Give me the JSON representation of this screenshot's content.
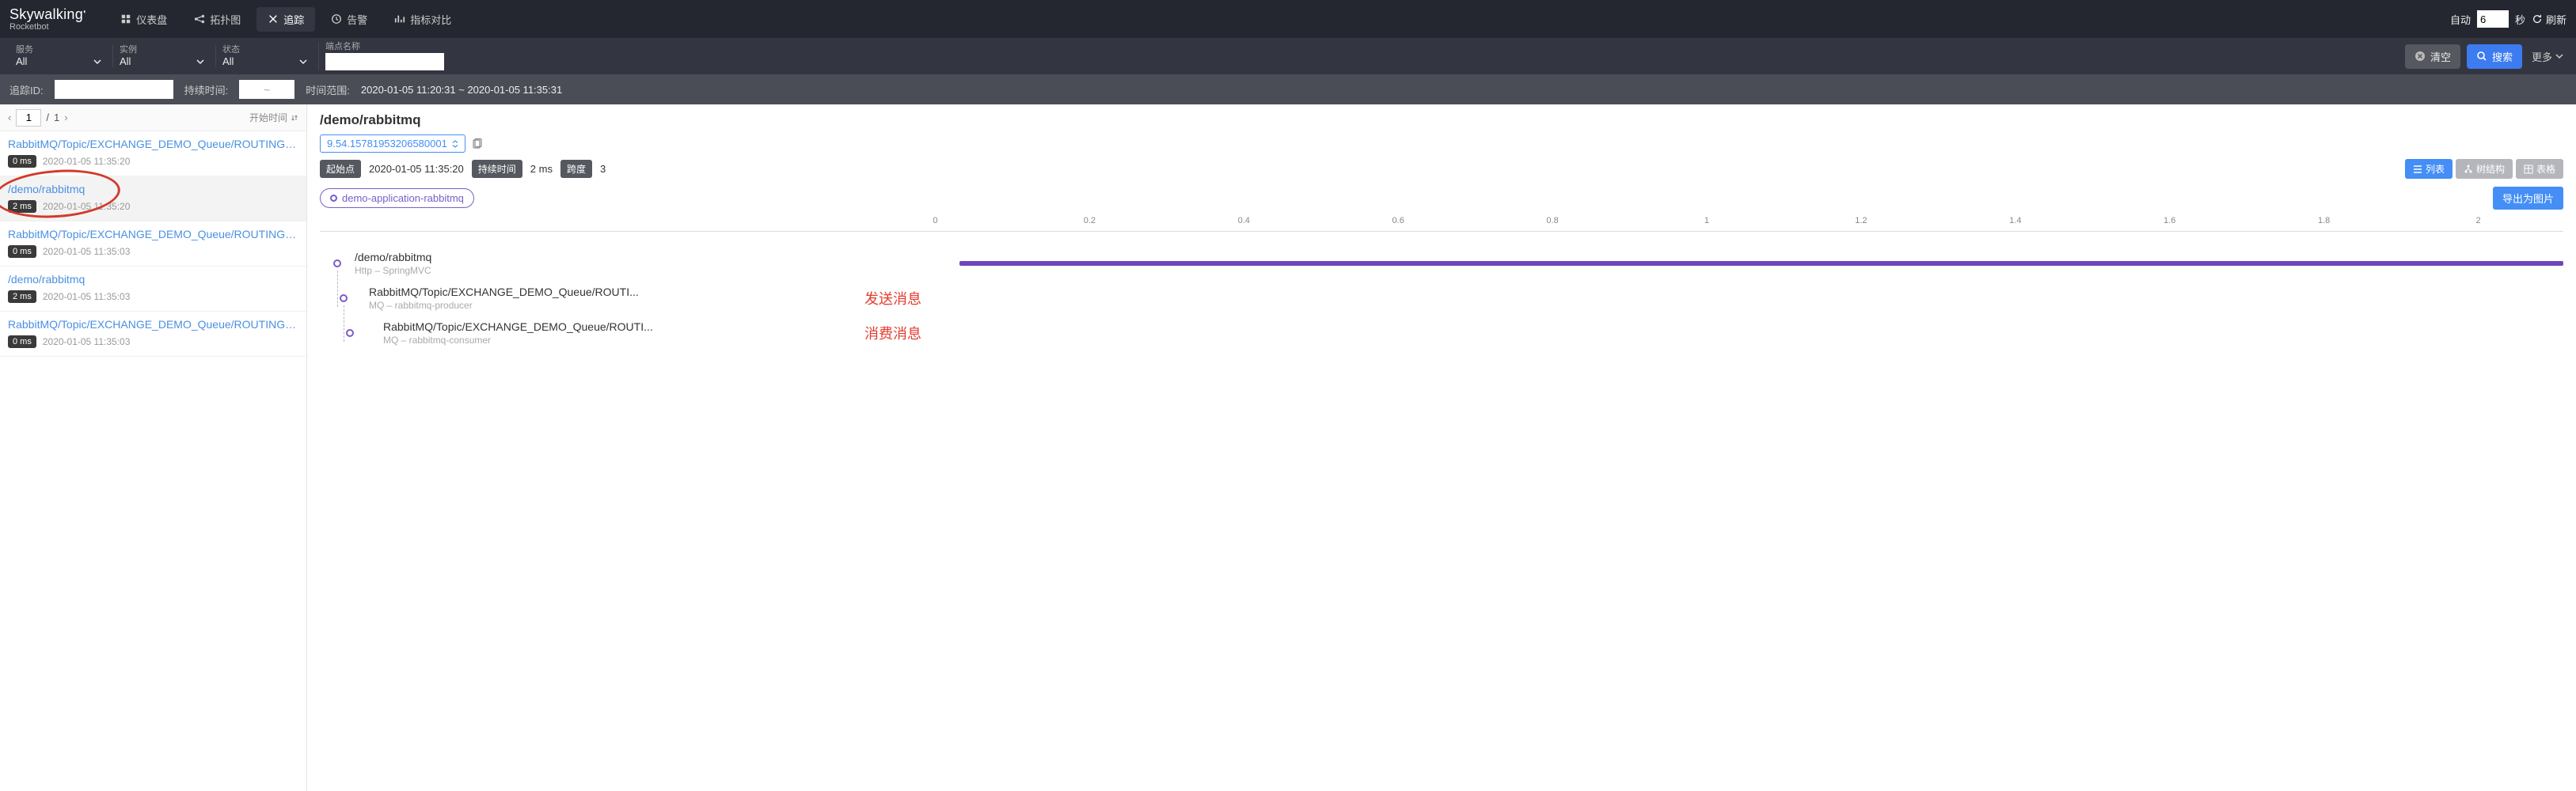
{
  "brand": {
    "main": "Skywalking",
    "sub": "Rocketbot"
  },
  "nav": {
    "dashboard": "仪表盘",
    "topology": "拓扑图",
    "trace": "追踪",
    "alarm": "告警",
    "compare": "指标对比"
  },
  "auto": {
    "label": "自动",
    "seconds": "6",
    "unit": "秒",
    "refresh": "刷新"
  },
  "filter": {
    "service_label": "服务",
    "service_value": "All",
    "instance_label": "实例",
    "instance_value": "All",
    "state_label": "状态",
    "state_value": "All",
    "endpoint_label": "端点名称",
    "endpoint_value": ""
  },
  "actions": {
    "clear": "清空",
    "search": "搜索",
    "more": "更多"
  },
  "filter2": {
    "traceid_label": "追踪ID:",
    "traceid_value": "",
    "duration_label": "持续时间:",
    "duration_value": "~",
    "timerange_label": "时间范围:",
    "timerange_value": "2020-01-05 11:20:31 ~ 2020-01-05 11:35:31"
  },
  "pager": {
    "page": "1",
    "total": "1"
  },
  "sort_label": "开始时间",
  "traces": [
    {
      "name": "RabbitMQ/Topic/EXCHANGE_DEMO_Queue/ROUTING_KEY...",
      "dur": "0 ms",
      "time": "2020-01-05 11:35:20",
      "selected": false,
      "marked": false
    },
    {
      "name": "/demo/rabbitmq",
      "dur": "2 ms",
      "time": "2020-01-05 11:35:20",
      "selected": true,
      "marked": true
    },
    {
      "name": "RabbitMQ/Topic/EXCHANGE_DEMO_Queue/ROUTING_KEY...",
      "dur": "0 ms",
      "time": "2020-01-05 11:35:03",
      "selected": false,
      "marked": false
    },
    {
      "name": "/demo/rabbitmq",
      "dur": "2 ms",
      "time": "2020-01-05 11:35:03",
      "selected": false,
      "marked": false
    },
    {
      "name": "RabbitMQ/Topic/EXCHANGE_DEMO_Queue/ROUTING_KEY...",
      "dur": "0 ms",
      "time": "2020-01-05 11:35:03",
      "selected": false,
      "marked": false
    }
  ],
  "detail": {
    "title": "/demo/rabbitmq",
    "trace_id": "9.54.15781953206580001",
    "start_label": "起始点",
    "start_value": "2020-01-05 11:35:20",
    "dur_label": "持续时间",
    "dur_value": "2 ms",
    "span_label": "跨度",
    "span_value": "3",
    "view_list": "列表",
    "view_tree": "树结构",
    "view_table": "表格",
    "legend": "demo-application-rabbitmq",
    "export": "导出为图片"
  },
  "axis_ticks": [
    "0",
    "0.2",
    "0.4",
    "0.6",
    "0.8",
    "1",
    "1.2",
    "1.4",
    "1.6",
    "1.8",
    "2"
  ],
  "spans": [
    {
      "name": "/demo/rabbitmq",
      "sub": "Http – SpringMVC",
      "indent": 0,
      "ann": ""
    },
    {
      "name": "RabbitMQ/Topic/EXCHANGE_DEMO_Queue/ROUTI...",
      "sub": "MQ – rabbitmq-producer",
      "indent": 1,
      "ann": "发送消息"
    },
    {
      "name": "RabbitMQ/Topic/EXCHANGE_DEMO_Queue/ROUTI...",
      "sub": "MQ – rabbitmq-consumer",
      "indent": 2,
      "ann": "消费消息"
    }
  ]
}
